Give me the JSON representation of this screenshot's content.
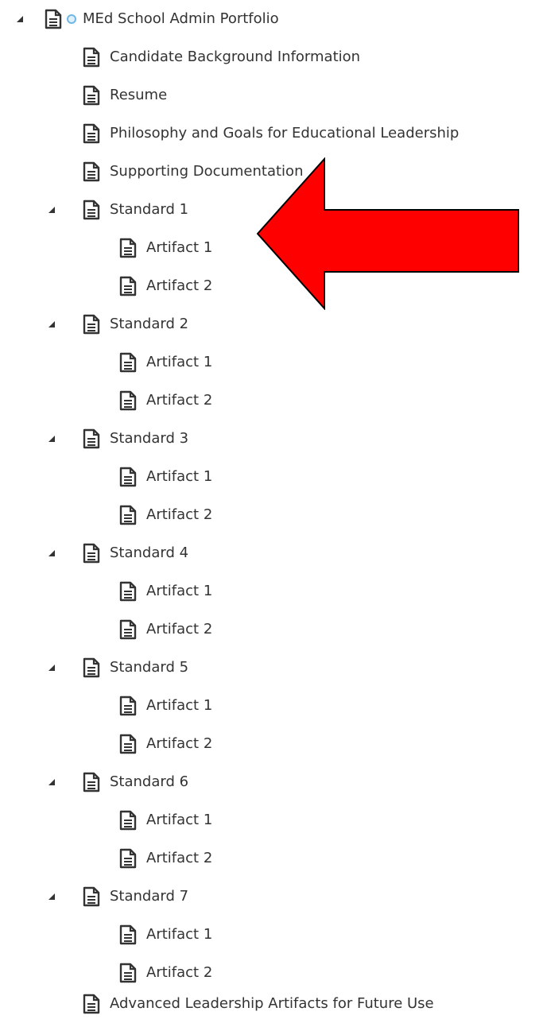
{
  "tree": {
    "root": {
      "label": "MEd School Admin Portfolio"
    },
    "sections": [
      {
        "label": "Candidate Background Information"
      },
      {
        "label": "Resume"
      },
      {
        "label": "Philosophy and Goals for Educational Leadership"
      },
      {
        "label": "Supporting Documentation"
      }
    ],
    "standards": [
      {
        "label": "Standard 1",
        "artifacts": [
          {
            "label": "Artifact 1"
          },
          {
            "label": "Artifact 2"
          }
        ]
      },
      {
        "label": "Standard 2",
        "artifacts": [
          {
            "label": "Artifact 1"
          },
          {
            "label": "Artifact 2"
          }
        ]
      },
      {
        "label": "Standard 3",
        "artifacts": [
          {
            "label": "Artifact 1"
          },
          {
            "label": "Artifact 2"
          }
        ]
      },
      {
        "label": "Standard 4",
        "artifacts": [
          {
            "label": "Artifact 1"
          },
          {
            "label": "Artifact 2"
          }
        ]
      },
      {
        "label": "Standard 5",
        "artifacts": [
          {
            "label": "Artifact 1"
          },
          {
            "label": "Artifact 2"
          }
        ]
      },
      {
        "label": "Standard 6",
        "artifacts": [
          {
            "label": "Artifact 1"
          },
          {
            "label": "Artifact 2"
          }
        ]
      },
      {
        "label": "Standard 7",
        "artifacts": [
          {
            "label": "Artifact 1"
          },
          {
            "label": "Artifact 2"
          }
        ]
      }
    ],
    "footer_item": {
      "label": "Advanced Leadership Artifacts for Future Use"
    }
  },
  "colors": {
    "annotation_arrow": "#ff0000",
    "status_circle": "#6fb7e6",
    "text": "#333333"
  },
  "icons": {
    "toggle": "expand-triangle-icon",
    "page": "document-icon",
    "status": "status-circle-icon",
    "annotation": "red-arrow-icon"
  }
}
